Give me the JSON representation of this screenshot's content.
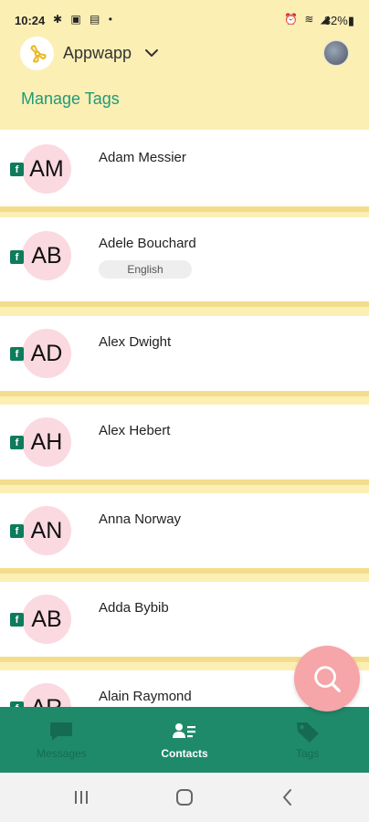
{
  "status_bar": {
    "time": "10:24",
    "left_icons": "✱ ▣ ▤ •",
    "right_icons": "⏰ ≋ ◢",
    "battery": "32%▮"
  },
  "header": {
    "app_name": "Appwapp",
    "manage_tags_label": "Manage Tags"
  },
  "contacts": [
    {
      "initials": "AM",
      "name": "Adam Messier",
      "tag": ""
    },
    {
      "initials": "AB",
      "name": "Adele Bouchard",
      "tag": "English"
    },
    {
      "initials": "AD",
      "name": "Alex Dwight",
      "tag": ""
    },
    {
      "initials": "AH",
      "name": "Alex Hebert",
      "tag": ""
    },
    {
      "initials": "AN",
      "name": "Anna Norway",
      "tag": ""
    },
    {
      "initials": "AB",
      "name": "Adda Bybib",
      "tag": ""
    },
    {
      "initials": "AR",
      "name": "Alain Raymond",
      "tag": ""
    }
  ],
  "fb_badge_letter": "f",
  "bottom_nav": {
    "messages_label": "Messages",
    "contacts_label": "Contacts",
    "tags_label": "Tags"
  },
  "colors": {
    "header_bg": "#FBEFB4",
    "accent_green": "#1F8A6A",
    "avatar_pink": "#FBD9E1",
    "fab_pink": "#F6A5A9"
  }
}
